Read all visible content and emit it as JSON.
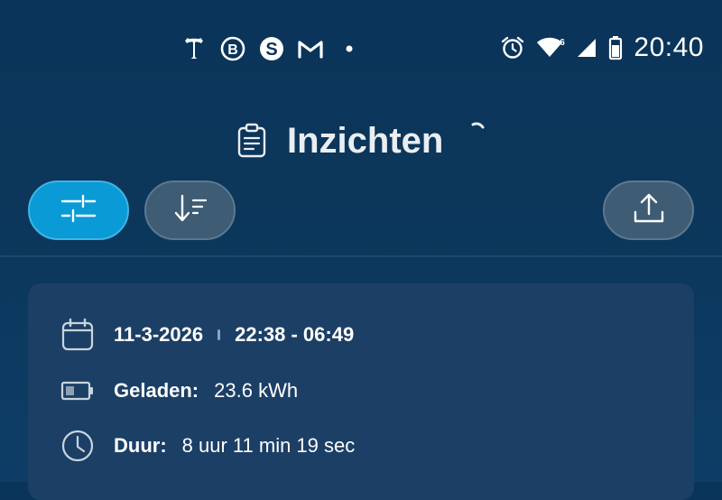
{
  "status_bar": {
    "time": "20:40",
    "notification_icons": [
      "telegraaf-t-icon",
      "b-circle-icon",
      "s-app-icon",
      "gmail-m-icon",
      "more-dot-icon"
    ],
    "system_icons": [
      "alarm-icon",
      "wifi-6-icon",
      "cell-signal-icon",
      "battery-icon"
    ],
    "wifi_badge": "6"
  },
  "header": {
    "title": "Inzichten",
    "title_icon": "clipboard-icon",
    "loading": true
  },
  "toolbar": {
    "filter_icon": "filter-sliders-icon",
    "sort_icon": "sort-icon",
    "export_icon": "share-upload-icon"
  },
  "session": {
    "date": "11-3-2026",
    "time_range": "22:38 - 06:49",
    "charged_label": "Geladen:",
    "charged_value": "23.6 kWh",
    "duration_label": "Duur:",
    "duration_value": "8 uur 11 min 19 sec"
  },
  "colors": {
    "background": "#0b355a",
    "accent": "#0a9ad6",
    "button_secondary": "#3e5c74",
    "card": "#1c3f66"
  }
}
